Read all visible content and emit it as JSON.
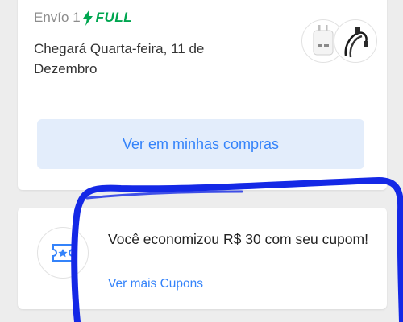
{
  "shipment": {
    "label": "Envío 1",
    "badge": "FULL",
    "arrival": "Chegará Quarta-feira, 11 de Dezembro",
    "items": [
      "charger-product-icon",
      "cable-product-icon"
    ],
    "button_label": "Ver em minhas compras"
  },
  "coupon": {
    "message": "Você economizou R$ 30 com seu cupom!",
    "link_label": "Ver mais Cupons",
    "icon": "coupon-star-icon"
  },
  "colors": {
    "full_green": "#00a650",
    "link_blue": "#3483fa",
    "button_bg": "#e3edfb",
    "annotation_blue": "#1428e6",
    "page_bg": "#ededed"
  }
}
